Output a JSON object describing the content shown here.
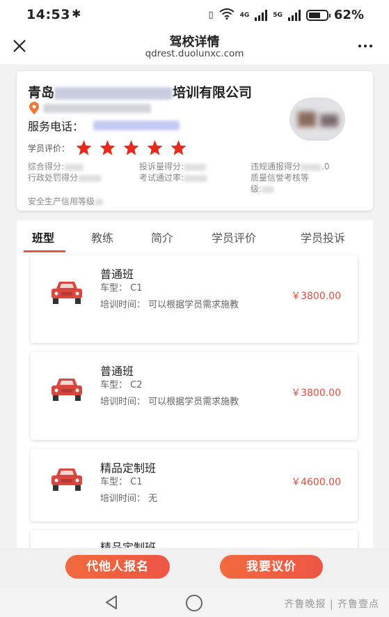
{
  "status_bar": {
    "time": "14:53",
    "network_4g": "4G",
    "network_5g": "5G",
    "battery": "62%"
  },
  "title_bar": {
    "title": "驾校详情",
    "url": "qdrest.duolunxc.com"
  },
  "school": {
    "name_prefix": "青岛",
    "name_suffix": "培训有限公司",
    "phone_label": "服务电话：",
    "rating_label": "学员评价：",
    "rating": 5,
    "stats": {
      "overall_label": "综合得分:",
      "complaint_label": "投诉量得分:",
      "violation_label": "违规通报得分",
      "violation_suffix": ".0",
      "penalty_label": "行政处罚得分",
      "pass_rate_label": "考试通过率:",
      "quality_label_1": "质量信誉考核等",
      "quality_label_2": "级:",
      "safety_label": "安全生产信用等级"
    }
  },
  "tabs": [
    "班型",
    "教练",
    "简介",
    "学员评价",
    "学员投诉"
  ],
  "courses": [
    {
      "name": "普通班",
      "car_type": "车型： C1",
      "training_time": "培训时间： 可以根据学员需求施教",
      "price": "￥3800.00"
    },
    {
      "name": "普通班",
      "car_type": "车型： C2",
      "training_time": "培训时间： 可以根据学员需求施教",
      "price": "￥3800.00"
    },
    {
      "name": "精品定制班",
      "car_type": "车型： C1",
      "training_time": "培训时间： 无",
      "price": "￥4600.00"
    },
    {
      "name": "精品定制班"
    }
  ],
  "actions": {
    "register_other": "代他人报名",
    "negotiate": "我要议价"
  },
  "watermark": "齐鲁晚报 | 齐鲁壹点",
  "colors": {
    "accent": "#ee5545",
    "price": "#e04b3b",
    "star": "#e8291c",
    "car": "#d8463e"
  }
}
